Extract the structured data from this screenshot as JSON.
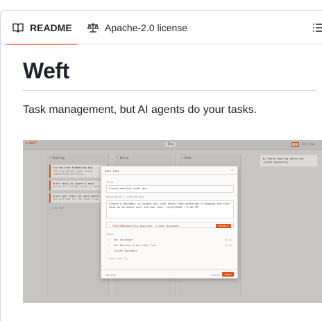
{
  "tabs": {
    "readme_label": "README",
    "readme_icon": "book-icon",
    "license_label": "Apache-2.0 license",
    "license_icon": "scale-icon",
    "outline_icon": "list-icon",
    "active_color": "#fd8c73"
  },
  "readme": {
    "title": "Weft",
    "tagline": "Task management, but AI agents do your tasks."
  },
  "screenshot": {
    "logo": "WEFT",
    "month": "Dec",
    "toolbar_chip": "3",
    "toolbar_text": "Settings",
    "columns": [
      {
        "title": "Backlog",
        "cards": [
          {
            "title": "Fix the tree formatting bug",
            "sub": "The tree walker shows wrong indentation and ticks."
          },
          {
            "title": "Draft reply to Lauren's email",
            "sub": "Review the thread, draft a reply."
          },
          {
            "title": "Write unit tests for auth module",
            "sub": "Add coverage for the login flow."
          }
        ],
        "add_label": "+ Add task"
      },
      {
        "title": "Doing",
        "cards": [],
        "add_label": ""
      },
      {
        "title": "Done",
        "cards": [],
        "add_label": ""
      }
    ],
    "note": "Create meeting notes doc (needs approval)",
    "modal": {
      "title": "Edit Task",
      "title_label": "Title",
      "title_value": "Create meeting notes doc",
      "desc_label": "Description / Instructions",
      "desc_value": "Create a document in Google Doc with notes from yesterday's standup and then send me an email with the doc link. 12/12/2025 • 5:46 PM",
      "status_tag": "• PENDING",
      "status_text": "Requesting approval: Create Document",
      "reject_label": "Reject",
      "steps_label": "Steps",
      "steps": [
        {
          "text": "Get Calendar",
          "time": "0.2s"
        },
        {
          "text": "Get Meeting Transcript Text",
          "time": "0.4s"
        },
        {
          "text": "Create Document",
          "time": ""
        }
      ],
      "steps_more": "+ show info (1)",
      "delete_label": "Delete",
      "cancel_label": "Cancel",
      "save_label": "Save",
      "accent": "#d9541e"
    }
  }
}
